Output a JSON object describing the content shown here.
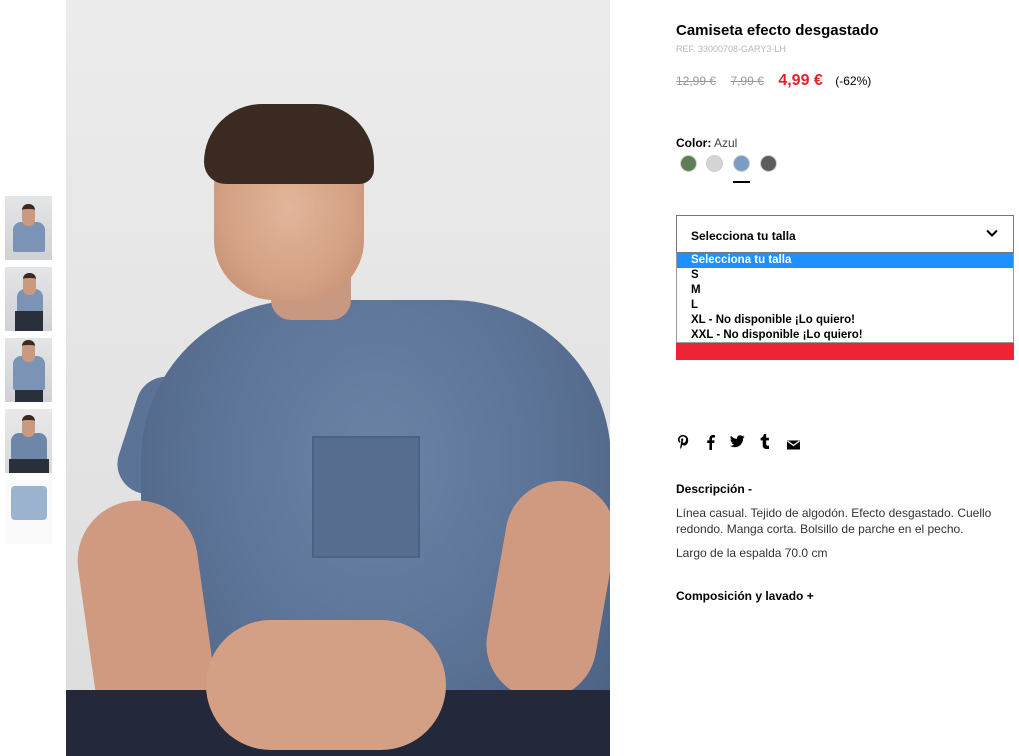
{
  "product": {
    "title": "Camiseta efecto desgastado",
    "ref": "REF. 33000708-GARY3-LH",
    "price_original": "12,99 €",
    "price_previous": "7,99 €",
    "price_current": "4,99 €",
    "discount": "(-62%)"
  },
  "color": {
    "label": "Color:",
    "value": "Azul",
    "swatches": [
      {
        "name": "verde",
        "hex": "#5c7f55"
      },
      {
        "name": "gris claro",
        "hex": "#d4d4d4"
      },
      {
        "name": "azul",
        "hex": "#7b9cc3",
        "selected": true
      },
      {
        "name": "gris oscuro",
        "hex": "#5c5c5c"
      }
    ]
  },
  "size_select": {
    "placeholder": "Selecciona tu talla",
    "options": [
      "Selecciona tu talla",
      "S",
      "M",
      "L",
      "XL - No disponible ¡Lo quiero!",
      "XXL - No disponible ¡Lo quiero!"
    ],
    "highlighted_index": 0
  },
  "share": {
    "icons": [
      "pinterest-icon",
      "facebook-icon",
      "twitter-icon",
      "tumblr-icon",
      "mail-icon"
    ]
  },
  "description": {
    "heading": "Descripción -",
    "text": "Línea casual. Tejido de algodón. Efecto desgastado. Cuello redondo. Manga corta. Bolsillo de parche en el pecho.",
    "length": "Largo de la espalda 70.0 cm"
  },
  "composition": {
    "heading": "Composición y lavado +"
  },
  "colors": {
    "accent_red": "#ee1c2e",
    "highlight_blue": "#1e90ff"
  }
}
